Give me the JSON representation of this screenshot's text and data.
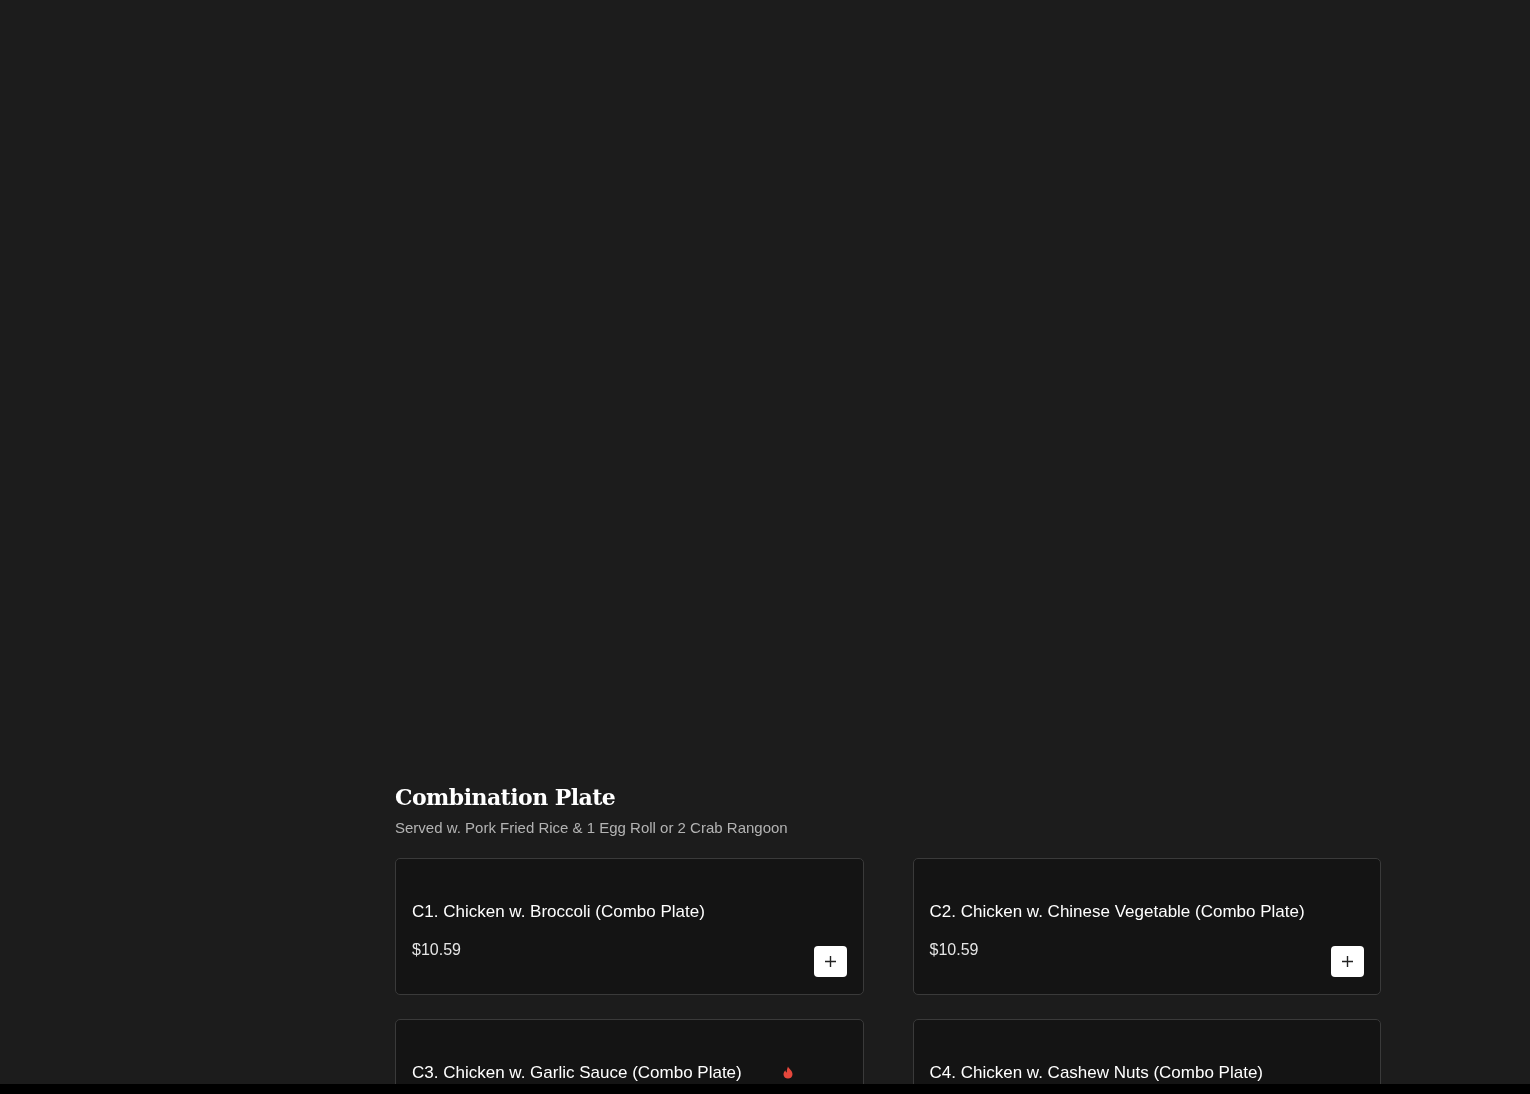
{
  "section": {
    "title": "Combination Plate",
    "subtitle": "Served w. Pork Fried Rice & 1 Egg Roll or 2 Crab Rangoon"
  },
  "items": [
    {
      "name": "C1. Chicken w. Broccoli (Combo Plate)",
      "price": "$10.59",
      "spicy": false
    },
    {
      "name": "C2. Chicken w. Chinese Vegetable (Combo Plate)",
      "price": "$10.59",
      "spicy": false
    },
    {
      "name": "C3. Chicken w. Garlic Sauce (Combo Plate)",
      "spicy": true
    },
    {
      "name": "C4. Chicken w. Cashew Nuts (Combo Plate)",
      "spicy": false
    }
  ]
}
